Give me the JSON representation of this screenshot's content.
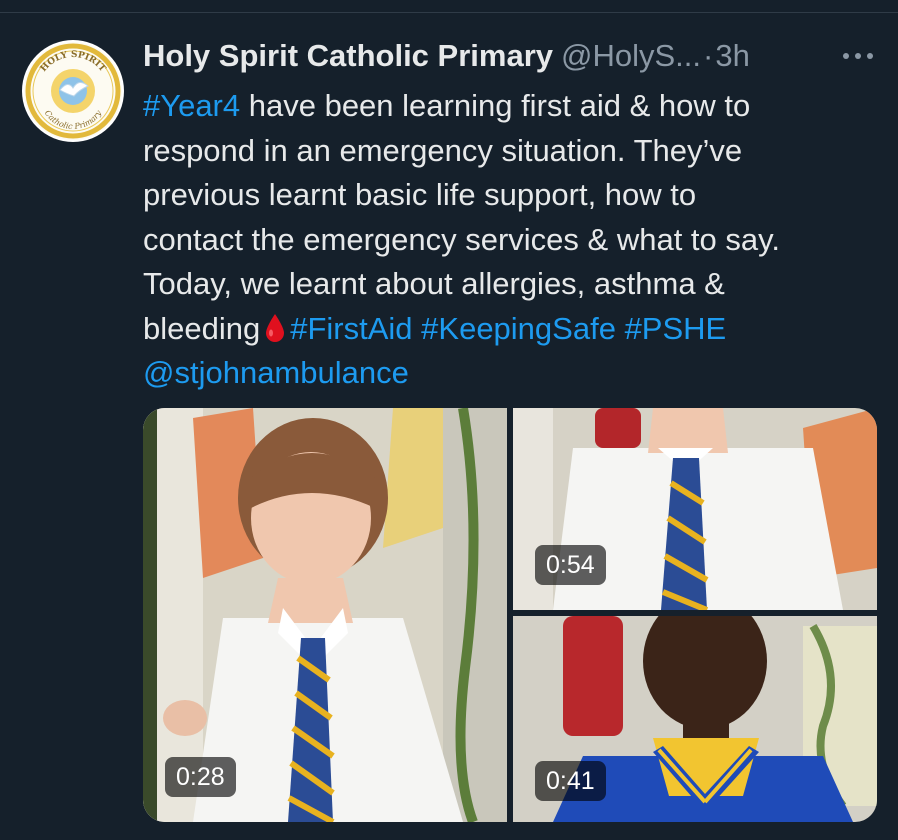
{
  "account": {
    "name": "Holy Spirit Catholic Primary",
    "handle": "@HolyS...",
    "separator": "·",
    "time": "3h",
    "avatar_text_top": "HOLY SPIRIT",
    "avatar_text_bottom": "Catholic Primary"
  },
  "tweet": {
    "hashtag_year4": "#Year4",
    "line1_rest": " have been learning first aid & how to",
    "line2": "respond in an emergency situation. They’ve",
    "line3": "previous learnt basic life support, how to",
    "line4": "contact the emergency services & what to say.",
    "line5": "Today, we learnt about allergies, asthma &",
    "line6_start": "bleeding",
    "hashtag_firstaid": "#FirstAid",
    "hashtag_keepingsafe": "#KeepingSafe",
    "hashtag_pshe": "#PSHE",
    "mention": "@stjohnambulance"
  },
  "media": [
    {
      "duration": "0:28"
    },
    {
      "duration": "0:54"
    },
    {
      "duration": "0:41"
    }
  ],
  "icons": {
    "more": "more-horizontal-icon",
    "drop": "drop-of-blood-icon"
  },
  "colors": {
    "background": "#15202b",
    "link": "#1d9bf0",
    "text": "#e7e9ea",
    "muted": "#8b98a5"
  }
}
